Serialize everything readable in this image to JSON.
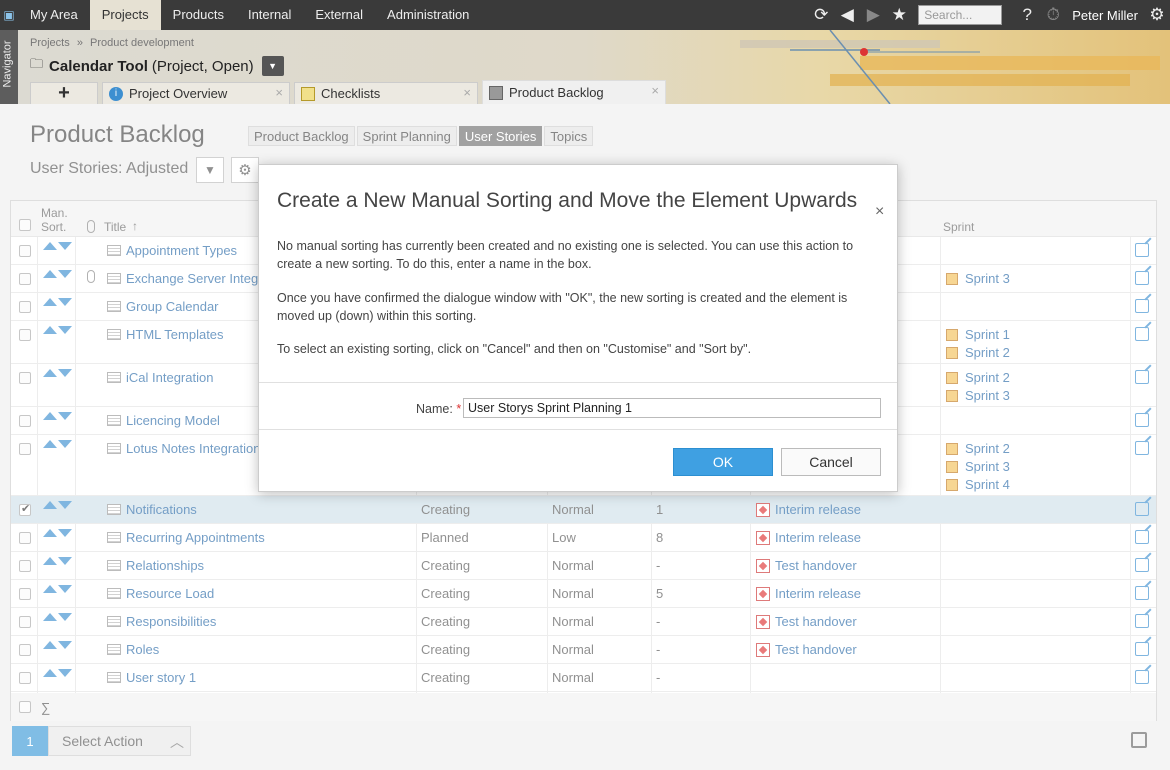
{
  "topnav": {
    "items": [
      "My Area",
      "Projects",
      "Products",
      "Internal",
      "External",
      "Administration"
    ],
    "active": "Projects",
    "search_placeholder": "Search...",
    "help": "?",
    "user": "Peter Miller"
  },
  "navigator_label": "Navigator",
  "breadcrumb": {
    "first": "Projects",
    "separator": "»",
    "second": "Product development"
  },
  "project": {
    "name": "Calendar Tool",
    "status": "(Project, Open)"
  },
  "tabs": [
    {
      "label": "+"
    },
    {
      "label": "Project Overview",
      "close": "×"
    },
    {
      "label": "Checklists",
      "close": "×"
    },
    {
      "label": "Product Backlog",
      "close": "×"
    }
  ],
  "page": {
    "title": "Product Backlog",
    "view_tabs": [
      "Product Backlog",
      "Sprint Planning",
      "User Stories",
      "Topics"
    ],
    "active_view": "User Stories",
    "view_name": "User Stories: Adjusted"
  },
  "table": {
    "headers": {
      "man_sort": "Man.",
      "man_sort2": "Sort.",
      "title": "Title",
      "title_sort": "↑",
      "sprint": "Sprint"
    },
    "rows": [
      {
        "title": "Appointment Types",
        "status": "",
        "priority": "",
        "num": "",
        "milestone": "",
        "sprints": []
      },
      {
        "title": "Exchange Server Integra",
        "status": "",
        "priority": "",
        "num": "",
        "milestone": "",
        "sprints": [
          "Sprint 3"
        ]
      },
      {
        "title": "Group Calendar",
        "status": "",
        "priority": "",
        "num": "",
        "milestone": "",
        "sprints": []
      },
      {
        "title": "HTML Templates",
        "status": "",
        "priority": "",
        "num": "",
        "milestone": "",
        "sprints": [
          "Sprint 1",
          "Sprint 2"
        ]
      },
      {
        "title": "iCal Integration",
        "status": "",
        "priority": "",
        "num": "",
        "milestone": "",
        "sprints": [
          "Sprint 2",
          "Sprint 3"
        ]
      },
      {
        "title": "Licencing Model",
        "status": "",
        "priority": "",
        "num": "",
        "milestone": "",
        "sprints": []
      },
      {
        "title": "Lotus Notes Integration",
        "status": "",
        "priority": "",
        "num": "",
        "milestone": "",
        "sprints": [
          "Sprint 2",
          "Sprint 3",
          "Sprint 4"
        ]
      },
      {
        "title": "Notifications",
        "status": "Creating",
        "priority": "Normal",
        "num": "1",
        "milestone": "Interim release",
        "sprints": []
      },
      {
        "title": "Recurring Appointments",
        "status": "Planned",
        "priority": "Low",
        "num": "8",
        "milestone": "Interim release",
        "sprints": []
      },
      {
        "title": "Relationships",
        "status": "Creating",
        "priority": "Normal",
        "num": "-",
        "milestone": "Test handover",
        "sprints": []
      },
      {
        "title": "Resource Load",
        "status": "Creating",
        "priority": "Normal",
        "num": "5",
        "milestone": "Interim release",
        "sprints": []
      },
      {
        "title": "Responsibilities",
        "status": "Creating",
        "priority": "Normal",
        "num": "-",
        "milestone": "Test handover",
        "sprints": []
      },
      {
        "title": "Roles",
        "status": "Creating",
        "priority": "Normal",
        "num": "-",
        "milestone": "Test handover",
        "sprints": []
      },
      {
        "title": "User story 1",
        "status": "Creating",
        "priority": "Normal",
        "num": "-",
        "milestone": "",
        "sprints": []
      }
    ],
    "sum_symbol": "∑"
  },
  "footer": {
    "selected_count": "1",
    "select_action": "Select Action"
  },
  "dialog": {
    "title": "Create a New Manual Sorting and Move the Element Upwards",
    "close": "×",
    "paragraph1": "No manual sorting has currently been created and no existing one is selected. You can use this action to create a new sorting. To do this, enter a name in the box.",
    "paragraph2": "Once you have confirmed the dialogue window with \"OK\", the new sorting is created and the element is moved up (down) within this sorting.",
    "paragraph3": "To select an existing sorting, click on \"Cancel\" and then on \"Customise\" and \"Sort by\".",
    "name_label": "Name:",
    "required_mark": "*",
    "name_value": "User Storys Sprint Planning 1",
    "ok": "OK",
    "cancel": "Cancel"
  }
}
